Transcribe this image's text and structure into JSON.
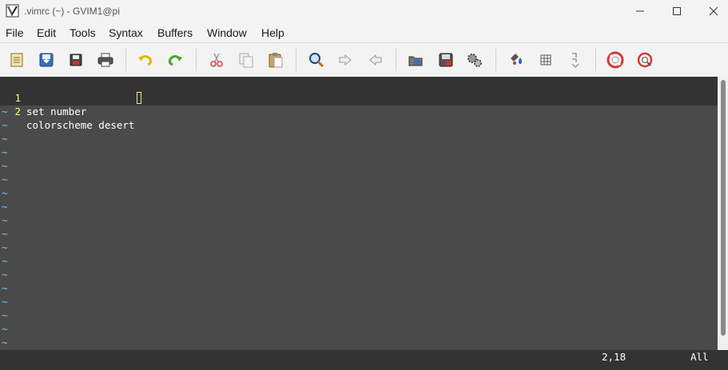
{
  "window": {
    "title": ".vimrc (~) - GVIM1@pi",
    "minimize_label": "—",
    "maximize_label": "☐",
    "close_label": "✕"
  },
  "menu": [
    "File",
    "Edit",
    "Tools",
    "Syntax",
    "Buffers",
    "Window",
    "Help"
  ],
  "toolbar_icons": [
    "open-icon",
    "save-icon",
    "save-all-icon",
    "print-icon",
    "undo-icon",
    "redo-icon",
    "cut-icon",
    "copy-icon",
    "paste-icon",
    "find-replace-icon",
    "find-next-icon",
    "find-previous-icon",
    "load-session-icon",
    "save-session-icon",
    "run-script-icon",
    "make-icon",
    "run-ctags-icon",
    "jump-to-tag-icon",
    "help-icon",
    "find-help-icon"
  ],
  "editor": {
    "lines": [
      {
        "num": "1",
        "text": "set number"
      },
      {
        "num": "2",
        "text": "colorscheme desert"
      }
    ],
    "tilde": "~",
    "tilde_count": 18
  },
  "status": {
    "position": "2,18",
    "scroll": "All"
  },
  "colors": {
    "editor_bg": "#4a4a4a",
    "line_number": "#ffff5f",
    "tilde": "#6dceeb",
    "status_bg": "#333333",
    "cursor": "#f0e68c"
  }
}
